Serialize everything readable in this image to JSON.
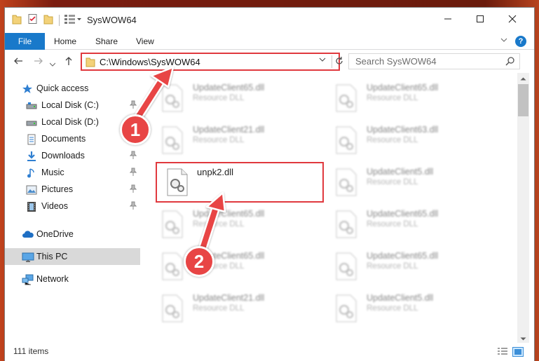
{
  "window": {
    "title": "SysWOW64",
    "colors": {
      "accent": "#1979ca",
      "highlight": "#e0393e",
      "badge": "#e84545"
    }
  },
  "ribbon": {
    "file_label": "File",
    "tabs": [
      {
        "label": "Home"
      },
      {
        "label": "Share"
      },
      {
        "label": "View"
      }
    ],
    "help_label": "?"
  },
  "nav": {
    "address": "C:\\Windows\\SysWOW64",
    "search_placeholder": "Search SysWOW64"
  },
  "sidebar": {
    "items": [
      {
        "label": "Quick access",
        "icon": "star-icon"
      },
      {
        "label": "Local Disk (C:)",
        "icon": "drive-icon"
      },
      {
        "label": "Local Disk (D:)",
        "icon": "drive-icon"
      },
      {
        "label": "Documents",
        "icon": "documents-icon"
      },
      {
        "label": "Downloads",
        "icon": "download-icon"
      },
      {
        "label": "Music",
        "icon": "music-icon"
      },
      {
        "label": "Pictures",
        "icon": "pictures-icon"
      },
      {
        "label": "Videos",
        "icon": "videos-icon"
      },
      {
        "label": "OneDrive",
        "icon": "cloud-icon"
      },
      {
        "label": "This PC",
        "icon": "computer-icon"
      },
      {
        "label": "Network",
        "icon": "network-icon"
      }
    ]
  },
  "files": [
    {
      "name": "UpdateClient65.dll",
      "type": "Resource DLL"
    },
    {
      "name": "UpdateClient65.dll",
      "type": "Resource DLL"
    },
    {
      "name": "UpdateClient21.dll",
      "type": "Resource DLL"
    },
    {
      "name": "UpdateClient63.dll",
      "type": "Resource DLL"
    },
    {
      "name": "unpk2.dll",
      "type": ""
    },
    {
      "name": "UpdateClient5.dll",
      "type": "Resource DLL"
    },
    {
      "name": "UpdateClient65.dll",
      "type": "Resource DLL"
    },
    {
      "name": "UpdateClient65.dll",
      "type": "Resource DLL"
    },
    {
      "name": "UpdateClient65.dll",
      "type": "Resource DLL"
    },
    {
      "name": "UpdateClient65.dll",
      "type": "Resource DLL"
    },
    {
      "name": "UpdateClient21.dll",
      "type": "Resource DLL"
    },
    {
      "name": "UpdateClient5.dll",
      "type": "Resource DLL"
    }
  ],
  "status": {
    "items_count": "111 items"
  },
  "annotations": {
    "step1": "1",
    "step2": "2"
  }
}
